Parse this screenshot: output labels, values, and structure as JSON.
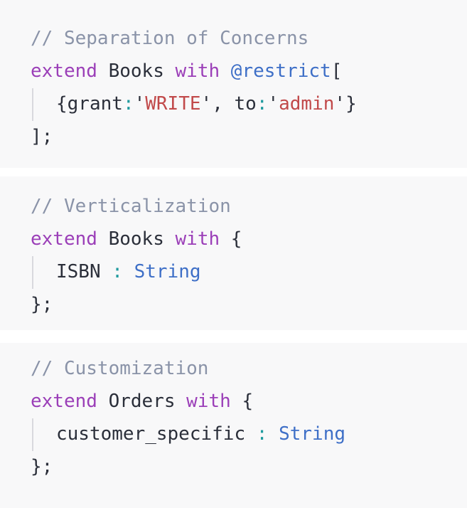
{
  "blocks": [
    {
      "comment": "// Separation of Concerns",
      "keyword1": "extend",
      "entity": "Books",
      "keyword2": "with",
      "decorator": "@restrict",
      "open": "[",
      "body": {
        "open_brace": "{",
        "key1": "grant",
        "colon1": ":",
        "quote1a": "'",
        "value1": "WRITE",
        "quote1b": "'",
        "comma": ", ",
        "key2": "to",
        "colon2": ":",
        "quote2a": "'",
        "value2": "admin",
        "quote2b": "'",
        "close_brace": "}"
      },
      "close": "];"
    },
    {
      "comment": "// Verticalization",
      "keyword1": "extend",
      "entity": "Books",
      "keyword2": "with",
      "open": "{",
      "field": "ISBN",
      "colon": ":",
      "type": "String",
      "close": "};"
    },
    {
      "comment": "// Customization",
      "keyword1": "extend",
      "entity": "Orders",
      "keyword2": "with",
      "open": "{",
      "field": "customer_specific",
      "colon": ":",
      "type": "String",
      "close": "};"
    }
  ],
  "colors": {
    "background": "#f8f8f9",
    "comment": "#8a93a8",
    "keyword": "#9b3fb8",
    "type": "#3e6fc7",
    "string": "#c1494a",
    "operator": "#1f9a9e",
    "text": "#2b2f3a"
  }
}
